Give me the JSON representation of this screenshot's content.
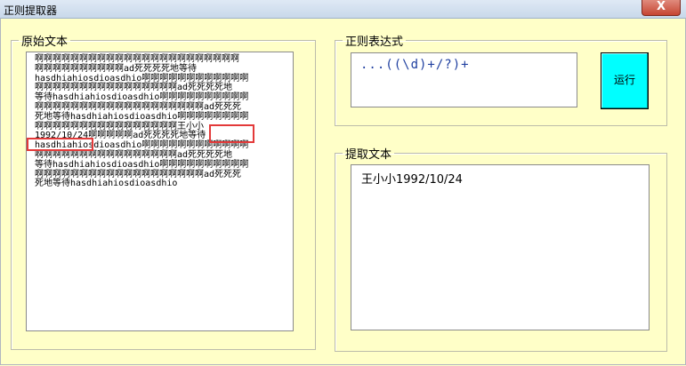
{
  "window": {
    "title": "正则提取器",
    "close_label": "X"
  },
  "original": {
    "legend": "原始文本",
    "lines": [
      "啊啊啊啊啊啊啊啊啊啊啊啊啊啊啊啊啊啊啊啊啊啊啊",
      "啊啊啊啊啊啊啊啊啊啊ad死死死死地等待",
      "hasdhiahiosdioasdhio啊啊啊啊啊啊啊啊啊啊啊啊",
      "啊啊啊啊啊啊啊啊啊啊啊啊啊啊啊啊ad死死死死地",
      "等待hasdhiahiosdioasdhio啊啊啊啊啊啊啊啊啊啊",
      "啊啊啊啊啊啊啊啊啊啊啊啊啊啊啊啊啊啊啊ad死死死",
      "死地等待hasdhiahiosdioasdhio啊啊啊啊啊啊啊啊",
      "啊啊啊啊啊啊啊啊啊啊啊啊啊啊啊啊王小小",
      "1992/10/24啊啊啊啊啊ad死死死死地等待",
      "hasdhiahiosdioasdhio啊啊啊啊啊啊啊啊啊啊啊啊",
      "啊啊啊啊啊啊啊啊啊啊啊啊啊啊啊啊ad死死死死地",
      "等待hasdhiahiosdioasdhio啊啊啊啊啊啊啊啊啊啊",
      "啊啊啊啊啊啊啊啊啊啊啊啊啊啊啊啊啊啊啊ad死死死",
      "死地等待hasdhiahiosdioasdhio"
    ]
  },
  "regex": {
    "legend": "正则表达式",
    "value": "...((\\d)+/?)+"
  },
  "run_button": {
    "label": "运行"
  },
  "result": {
    "legend": "提取文本",
    "value": "王小小1992/10/24"
  },
  "highlight_color": "#e33a3a",
  "run_button_color": "#00ffff",
  "background_color": "#ffffc8"
}
